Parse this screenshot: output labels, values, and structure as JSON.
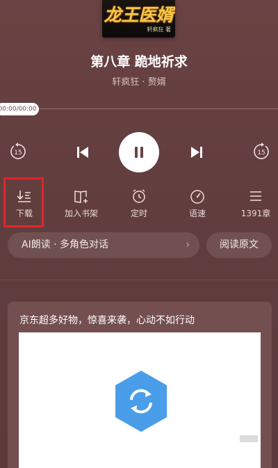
{
  "cover": {
    "title": "龙王医婿",
    "author": "轩疯狂 著"
  },
  "chapter_title": "第八章 跪地祈求",
  "book_meta": "轩疯狂 · 赘婿",
  "player": {
    "time_display": "00:00/00:00",
    "progress_fraction": 0,
    "skip_back_seconds": "15",
    "skip_forward_seconds": "15",
    "state": "playing"
  },
  "functions": [
    {
      "label": "下载",
      "icon": "download-icon"
    },
    {
      "label": "加入书架",
      "icon": "bookshelf-add-icon"
    },
    {
      "label": "定时",
      "icon": "alarm-clock-icon"
    },
    {
      "label": "语速",
      "icon": "speed-icon"
    },
    {
      "label": "1391章",
      "icon": "chapter-list-icon"
    }
  ],
  "ai_pill": {
    "label": "AI朗读 · 多角色对话",
    "chevron": "›"
  },
  "read_original_label": "阅读原文",
  "ad": {
    "text": "京东超多好物，惊喜来袭，心动不如行动"
  },
  "colors": {
    "background": "#613d3e",
    "highlight_box": "#e0262b",
    "ad_card": "#744f50",
    "ad_icon": "#4a9de8"
  }
}
